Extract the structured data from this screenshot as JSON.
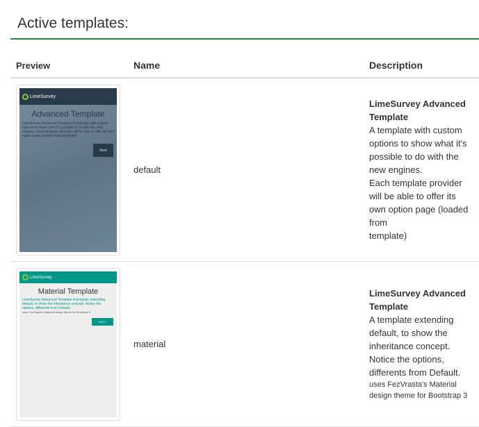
{
  "heading": "Active templates:",
  "columns": {
    "preview": "Preview",
    "name": "Name",
    "description": "Description"
  },
  "colors": {
    "accent": "#328637"
  },
  "templates": [
    {
      "name": "default",
      "preview": {
        "logo": "LimeSurvey",
        "title": "Advanced Template",
        "text": "LimeSurvey Advanced Template A template with custom options to show what it's possible to do with the new engines. Each template provider will be able to offer its own option page (loaded from template)",
        "button": "Next"
      },
      "desc_title": "LimeSurvey Advanced Template",
      "desc_lines": [
        "A template with custom options to show what it's possible to do with the new engines.",
        "Each template provider will be able to offer its own option page (loaded from",
        "template)"
      ]
    },
    {
      "name": "material",
      "preview": {
        "logo": "LimeSurvey",
        "title": "Material Template",
        "text": "LimeSurvey Advanced Template A template extending default, to show the inheritance concept. Notice the options, differents from Default.",
        "small": "uses FezVrasta's Material design theme for Bootstrap 3",
        "button": "NEXT"
      },
      "desc_title": "LimeSurvey Advanced Template",
      "desc_lines": [
        "A template extending default, to show the inheritance concept. Notice the options,",
        "differents from Default."
      ],
      "desc_small": "uses FezVrasta's Material design theme for Bootstrap 3"
    }
  ]
}
